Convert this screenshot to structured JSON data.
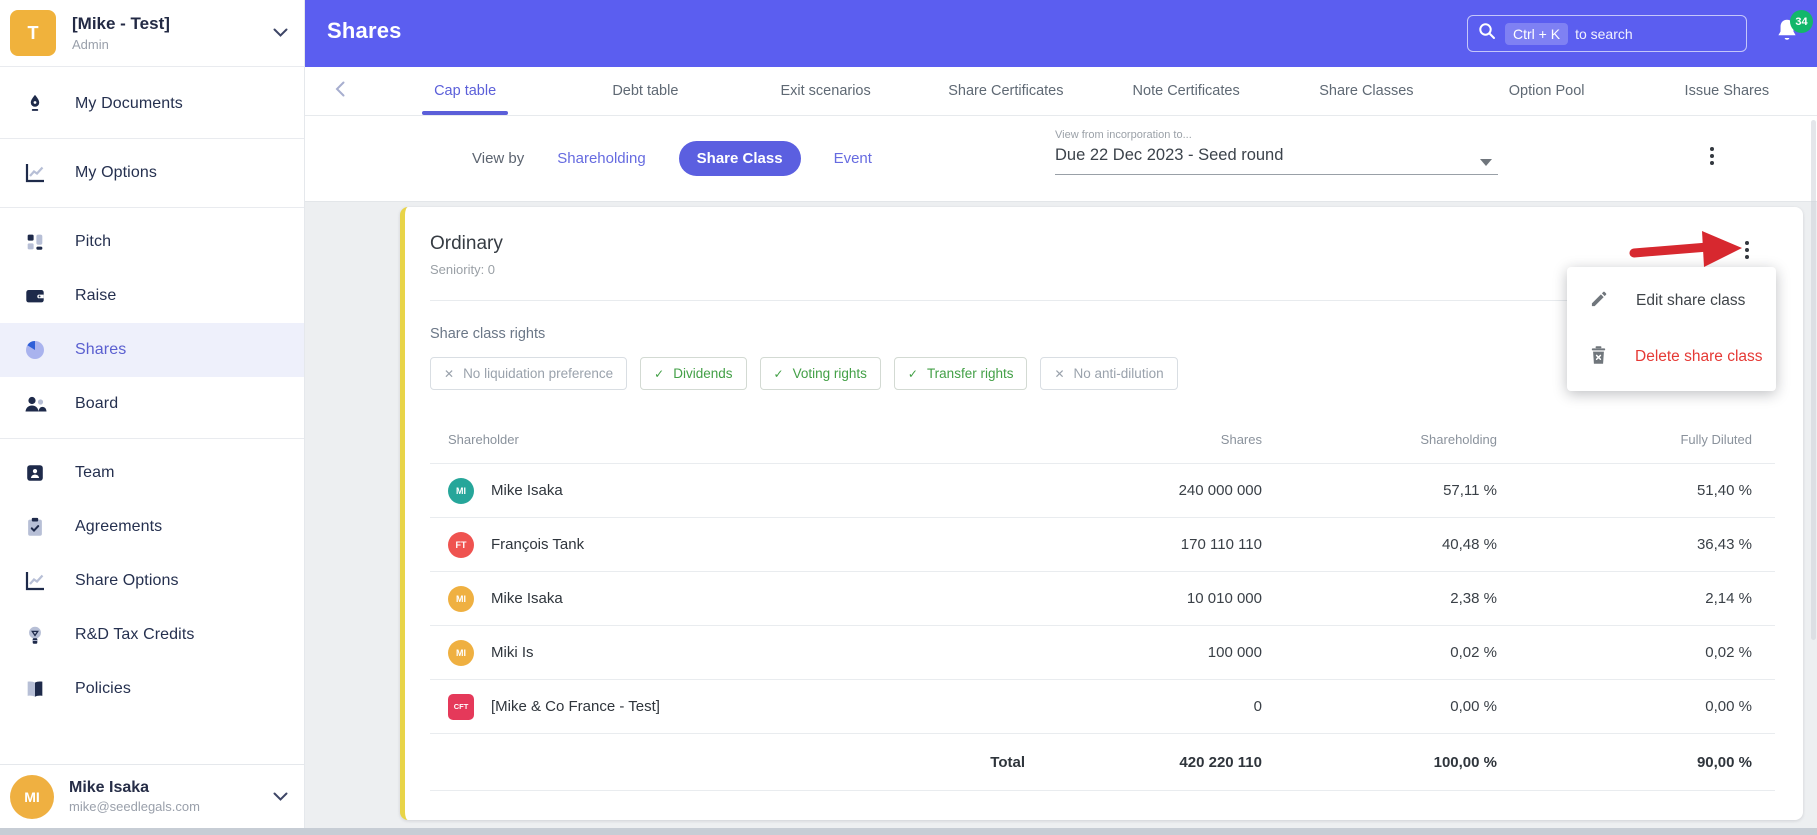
{
  "colors": {
    "header_accent": "#5b5ef0",
    "active_link": "#5b5fd9",
    "card_stripe": "#e8d448",
    "delete_red": "#e53935",
    "annotation_arrow_red": "#d7282f",
    "notification_badge_green": "#12b76a",
    "chip_on_green": "#43a047",
    "avatar_colors": [
      "#26a69a",
      "#ef5350",
      "#efb041",
      "#efb041",
      "#e5395a"
    ]
  },
  "sidebar": {
    "company": {
      "initial": "T",
      "name": "[Mike - Test]",
      "role": "Admin"
    },
    "items": [
      {
        "label": "My Documents",
        "icon": "pen-nib-icon"
      },
      {
        "label": "My Options",
        "icon": "chart-line-icon"
      },
      {
        "label": "Pitch",
        "icon": "grid-icon"
      },
      {
        "label": "Raise",
        "icon": "wallet-icon"
      },
      {
        "label": "Shares",
        "icon": "pie-chart-icon",
        "active": true
      },
      {
        "label": "Board",
        "icon": "people-icon"
      },
      {
        "label": "Team",
        "icon": "badge-icon"
      },
      {
        "label": "Agreements",
        "icon": "clipboard-check-icon"
      },
      {
        "label": "Share Options",
        "icon": "chart-line-icon"
      },
      {
        "label": "R&D Tax Credits",
        "icon": "lightbulb-icon"
      },
      {
        "label": "Policies",
        "icon": "book-icon"
      }
    ],
    "user": {
      "initials": "MI",
      "name": "Mike Isaka",
      "email": "mike@seedlegals.com"
    }
  },
  "header": {
    "title": "Shares",
    "search": {
      "shortcut": "Ctrl + K",
      "hint": "to search"
    },
    "notifications": {
      "count": "34"
    }
  },
  "tabs": {
    "items": [
      {
        "label": "Cap table",
        "active": true
      },
      {
        "label": "Debt table"
      },
      {
        "label": "Exit scenarios"
      },
      {
        "label": "Share Certificates"
      },
      {
        "label": "Note Certificates"
      },
      {
        "label": "Share Classes"
      },
      {
        "label": "Option Pool"
      },
      {
        "label": "Issue Shares"
      }
    ]
  },
  "filters": {
    "view_by_label": "View by",
    "options": [
      {
        "label": "Shareholding"
      },
      {
        "label": "Share Class",
        "selected": true
      },
      {
        "label": "Event"
      }
    ],
    "period": {
      "label": "View from incorporation to...",
      "value": "Due 22 Dec 2023 - Seed round"
    }
  },
  "share_class_card": {
    "name": "Ordinary",
    "seniority": "Seniority: 0",
    "rights_label": "Share class rights",
    "rights": [
      {
        "label": "No liquidation preference",
        "state": "off",
        "glyph": "✕"
      },
      {
        "label": "Dividends",
        "state": "on",
        "glyph": "✓"
      },
      {
        "label": "Voting rights",
        "state": "on",
        "glyph": "✓"
      },
      {
        "label": "Transfer rights",
        "state": "on",
        "glyph": "✓"
      },
      {
        "label": "No anti-dilution",
        "state": "off",
        "glyph": "✕"
      }
    ],
    "table": {
      "columns": {
        "shareholder": "Shareholder",
        "shares": "Shares",
        "shareholding": "Shareholding",
        "fully_diluted": "Fully Diluted"
      },
      "rows": [
        {
          "name": "Mike Isaka",
          "initials": "MI",
          "shares": "240 000 000",
          "shareholding": "57,11 %",
          "fully_diluted": "51,40 %"
        },
        {
          "name": "François Tank",
          "initials": "FT",
          "shares": "170 110 110",
          "shareholding": "40,48 %",
          "fully_diluted": "36,43 %"
        },
        {
          "name": "Mike Isaka",
          "initials": "MI",
          "shares": "10 010 000",
          "shareholding": "2,38 %",
          "fully_diluted": "2,14 %"
        },
        {
          "name": "Miki Is",
          "initials": "MI",
          "shares": "100 000",
          "shareholding": "0,02 %",
          "fully_diluted": "0,02 %"
        },
        {
          "name": "[Mike & Co France - Test]",
          "initials": "CFT",
          "shares": "0",
          "shareholding": "0,00 %",
          "fully_diluted": "0,00 %"
        }
      ],
      "total": {
        "label": "Total",
        "shares": "420 220 110",
        "shareholding": "100,00 %",
        "fully_diluted": "90,00 %"
      }
    }
  },
  "context_menu": {
    "items": [
      {
        "label": "Edit share class",
        "icon": "pencil-icon"
      },
      {
        "label": "Delete share class",
        "icon": "trash-icon"
      }
    ]
  }
}
